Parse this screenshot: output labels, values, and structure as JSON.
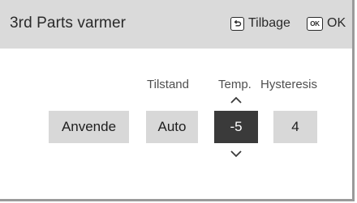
{
  "header": {
    "title": "3rd Parts varmer",
    "back_label": "Tilbage",
    "ok_label": "OK",
    "ok_icon_text": "OK",
    "back_icon": "back-return-icon",
    "ok_icon": "ok-key-icon"
  },
  "columns": {
    "mode_label": "Tilstand",
    "temp_label": "Temp.",
    "hysteresis_label": "Hysteresis"
  },
  "controls": {
    "apply_label": "Anvende",
    "mode_value": "Auto",
    "temp_value": "-5",
    "hysteresis_value": "4"
  },
  "colors": {
    "header_bg": "#dadada",
    "button_bg": "#d8d8d8",
    "selected_bg": "#3a3a3a",
    "selected_text": "#ffffff"
  }
}
